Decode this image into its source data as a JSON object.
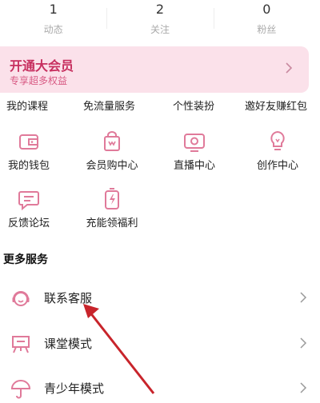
{
  "stats": [
    {
      "count": "1",
      "label": "动态"
    },
    {
      "count": "2",
      "label": "关注"
    },
    {
      "count": "0",
      "label": "粉丝"
    }
  ],
  "vip_banner": {
    "title": "开通大会员",
    "subtitle": "专享超多权益"
  },
  "top_row": [
    "我的课程",
    "免流量服务",
    "个性装扮",
    "邀好友赚红包"
  ],
  "grid": {
    "row1": [
      {
        "label": "我的钱包",
        "icon": "wallet-icon"
      },
      {
        "label": "会员购中心",
        "icon": "shopping-bag-icon"
      },
      {
        "label": "直播中心",
        "icon": "live-tv-icon"
      },
      {
        "label": "创作中心",
        "icon": "lightbulb-icon"
      }
    ],
    "row2": [
      {
        "label": "反馈论坛",
        "icon": "chat-bubble-icon"
      },
      {
        "label": "充能领福利",
        "icon": "battery-bolt-icon"
      }
    ]
  },
  "more_services": {
    "title": "更多服务",
    "items": [
      {
        "label": "联系客服",
        "icon": "headset-icon"
      },
      {
        "label": "课堂模式",
        "icon": "classroom-icon"
      },
      {
        "label": "青少年模式",
        "icon": "umbrella-icon"
      }
    ]
  },
  "colors": {
    "accent": "#c72f5f",
    "icon_pink": "#e07a9a",
    "banner_bg": "#fbe1ea",
    "arrow_red": "#c8242b"
  }
}
